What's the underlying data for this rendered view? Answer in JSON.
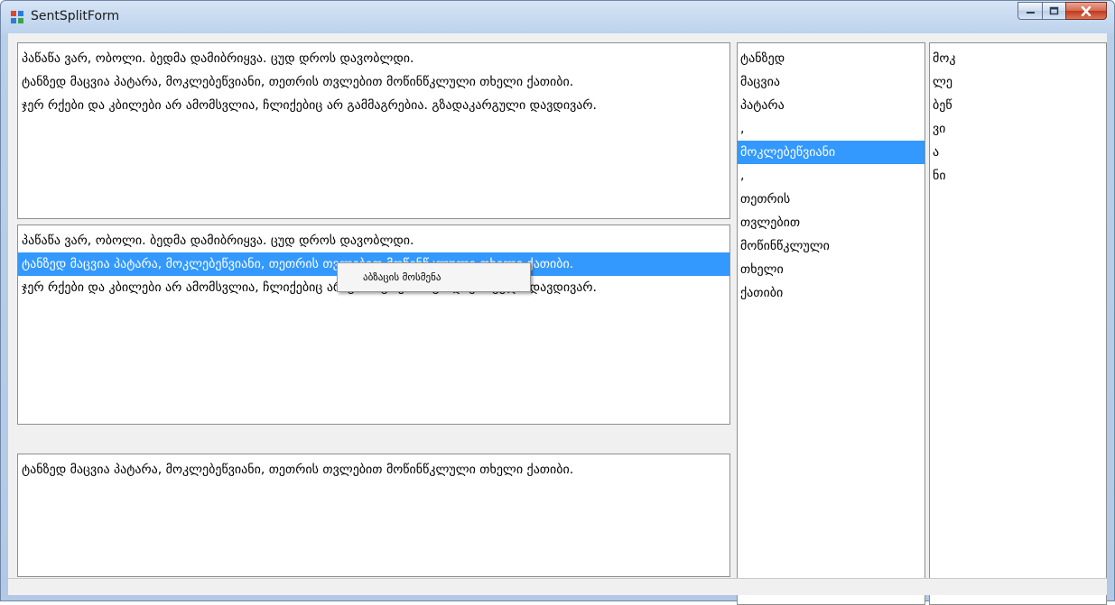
{
  "window": {
    "title": "SentSplitForm"
  },
  "paragraph_box": {
    "lines": [
      "პაწაწა ვარ, ობოლი. ბედმა დამიბრიყვა. ცუდ დროს დავობლდი.",
      "ტანზედ მაცვია პატარა, მოკლებეწვიანი, თეთრის თვლებით მოწინწკლული თხელი ქათიბი.",
      "ჯერ რქები და კბილები არ ამომსვლია, ჩლიქებიც არ გამმაგრებია. გზადაკარგული დავდივარ."
    ]
  },
  "sentence_list": {
    "rows": [
      "პაწაწა ვარ, ობოლი. ბედმა დამიბრიყვა. ცუდ დროს დავობლდი.",
      "ტანზედ მაცვია პატარა, მოკლებეწვიანი, თეთრის თვლებით მოწინწკლული თხელი ქათიბი.",
      "ჯერ რქები და კბილები არ ამომსვლია, ჩლიქებიც არ გამმაგრებია. გზადაკარგული დავდივარ."
    ],
    "selected_index": 1
  },
  "context_menu": {
    "item_label": "აბზაცის მოსმენა"
  },
  "selected_sentence_box": {
    "text": "ტანზედ მაცვია პატარა, მოკლებეწვიანი, თეთრის თვლებით მოწინწკლული თხელი ქათიბი."
  },
  "words_list": {
    "items": [
      "ტანზედ",
      "მაცვია",
      "პატარა",
      ",",
      "მოკლებეწვიანი",
      ",",
      "თეთრის",
      "თვლებით",
      "მოწინწკლული",
      "თხელი",
      "ქათიბი"
    ],
    "selected_index": 4
  },
  "chars_list": {
    "items": [
      "მოკ",
      "ლე",
      "ბეწ",
      "ვი",
      "ა",
      "ნი"
    ]
  },
  "colors": {
    "selection": "#3399ff",
    "close_button": "#c2391b"
  },
  "icons": {
    "app": "form-icon",
    "minimize": "minimize-icon",
    "maximize": "maximize-icon",
    "close": "close-icon"
  }
}
